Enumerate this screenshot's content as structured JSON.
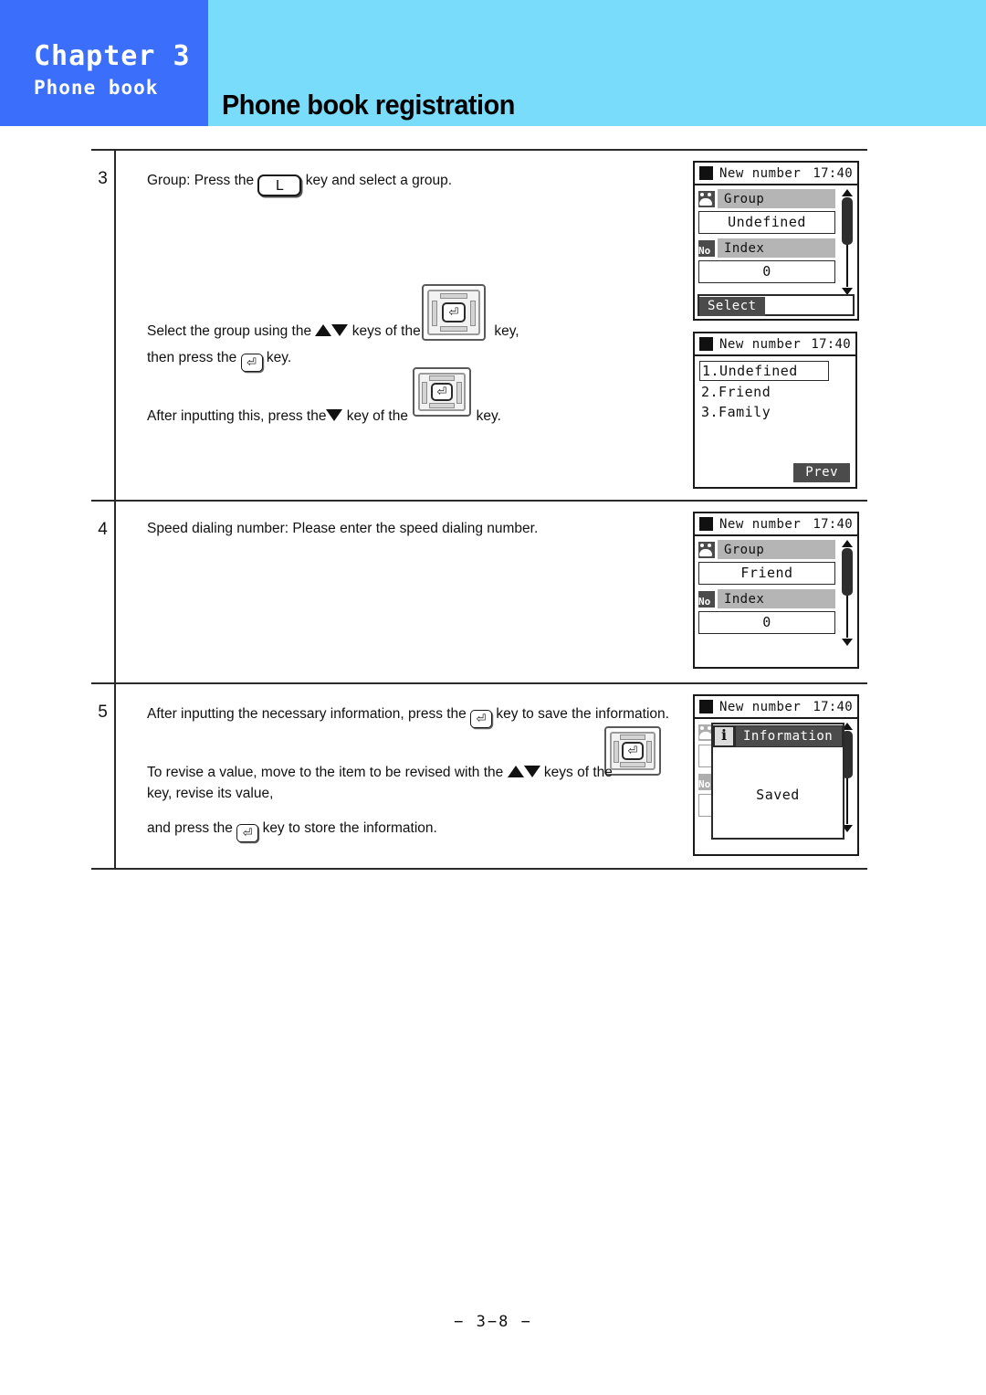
{
  "header": {
    "chapter_label": "Chapter 3",
    "chapter_sub": "Phone book",
    "page_title": "Phone book registration",
    "chapter_bg": "#3b6efa",
    "band_bg": "#7adcfb"
  },
  "steps": [
    {
      "number": "3",
      "lines": [
        {
          "id": "l1",
          "pre": "Group: Press the",
          "key": "key-wide-L",
          "key_label": "L",
          "post": "key and select a group."
        },
        {
          "id": "l2",
          "pre": "Select the group using the",
          "mid": "keys of the",
          "post": "key,"
        },
        {
          "id": "l3",
          "pre": "then press the",
          "post": "key."
        },
        {
          "id": "l4",
          "pre": "After inputting this, press the",
          "mid": "key of the",
          "post": "key."
        }
      ]
    },
    {
      "number": "4",
      "lines": [
        {
          "id": "l1",
          "text": "Speed dialing number:  Please enter the speed dialing number."
        }
      ]
    },
    {
      "number": "5",
      "lines": [
        {
          "id": "l1",
          "pre": "After inputting the necessary information,  press the",
          "post": "key to save the information."
        },
        {
          "id": "l2",
          "pre": "To revise a value, move to the item to be revised with the",
          "mid": "keys of the"
        },
        {
          "id": "l3",
          "text": "key, revise its value,"
        },
        {
          "id": "l4",
          "pre": "and press the",
          "post": "key to store the information."
        }
      ]
    }
  ],
  "screens": {
    "group_undefined": {
      "title": "New number",
      "clock": "17:40",
      "fields": [
        {
          "icon": "group-icon",
          "label": "Group",
          "value": "Undefined"
        },
        {
          "icon": "number-icon",
          "icon_text": "No",
          "label": "Index",
          "value": "0"
        }
      ],
      "softkey": "Select"
    },
    "group_list": {
      "title": "New number",
      "clock": "17:40",
      "items": [
        {
          "label": "1.Undefined",
          "selected": true
        },
        {
          "label": "2.Friend",
          "selected": false
        },
        {
          "label": "3.Family",
          "selected": false
        }
      ],
      "softkey": "Prev"
    },
    "group_friend": {
      "title": "New number",
      "clock": "17:40",
      "fields": [
        {
          "icon": "group-icon",
          "label": "Group",
          "value": "Friend"
        },
        {
          "icon": "number-icon",
          "icon_text": "No",
          "label": "Index",
          "value": "0"
        }
      ]
    },
    "saved_dialog": {
      "title": "New number",
      "clock": "17:40",
      "dialog_icon": "info-icon",
      "dialog_title": "Information",
      "dialog_message": "Saved"
    }
  },
  "footer": {
    "page_number": "− 3−8 −"
  }
}
